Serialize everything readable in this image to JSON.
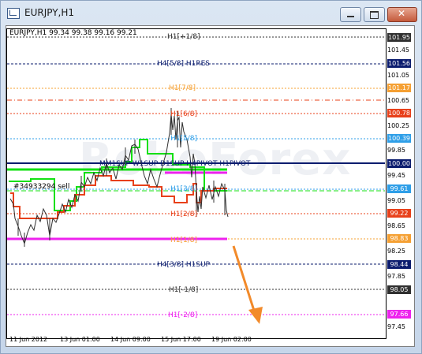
{
  "window": {
    "title": "EURJPY,H1",
    "close_glyph": "✕",
    "icons": [
      "app-icon",
      "minimize-icon",
      "maximize-icon",
      "close-icon"
    ]
  },
  "chart": {
    "header": "EURJPY,H1  99.34 99.38 99.16 99.21",
    "watermark": "RoboForex",
    "annotation": "#34933294 sell",
    "level_labels": {
      "h1_p18": "H1[+1/8]",
      "h4_58": "H4[5/8] H1RES",
      "h1_78": "H1[7/8]",
      "h1_68": "H1[6/8]",
      "h1_58": "H1[5/8]",
      "pivot": "MM1SUP W1SUP D1SUP H4PIVOT H1PIVOT",
      "h1_38": "H1[3/8]",
      "h1_28": "H1[2/8]",
      "h1_18": "H1[1/8]",
      "h4_38": "H4[3/8] H1SUP",
      "h1_m18": "H1[-1/8]",
      "h1_m28": "H1[-2/8]"
    },
    "price_labels": {
      "p10195": "101.95",
      "p10156": "101.56",
      "p10117": "101.17",
      "p10078": "100.78",
      "p10039": "100.39",
      "p10000": "100.00",
      "p9961": "99.61",
      "p9922": "99.22",
      "p9883": "98.83",
      "p9844": "98.44",
      "p9805": "98.05",
      "p9766": "97.66"
    },
    "y_ticks": [
      "101.45",
      "101.05",
      "100.65",
      "100.25",
      "99.85",
      "99.45",
      "99.05",
      "98.65",
      "98.25",
      "97.85",
      "97.45"
    ],
    "x_ticks": [
      "11 Jun 2012",
      "13 Jun 01:00",
      "14 Jun 09:00",
      "15 Jun 17:00",
      "19 Jun 02:00"
    ],
    "colors": {
      "orange": "#f5a033",
      "red": "#e8401a",
      "navy": "#0b1c6e",
      "green": "#14e014",
      "magenta": "#ee22ee",
      "skyblue": "#2f9fe8",
      "dark": "#303030",
      "arrow": "#f28a2a"
    }
  }
}
